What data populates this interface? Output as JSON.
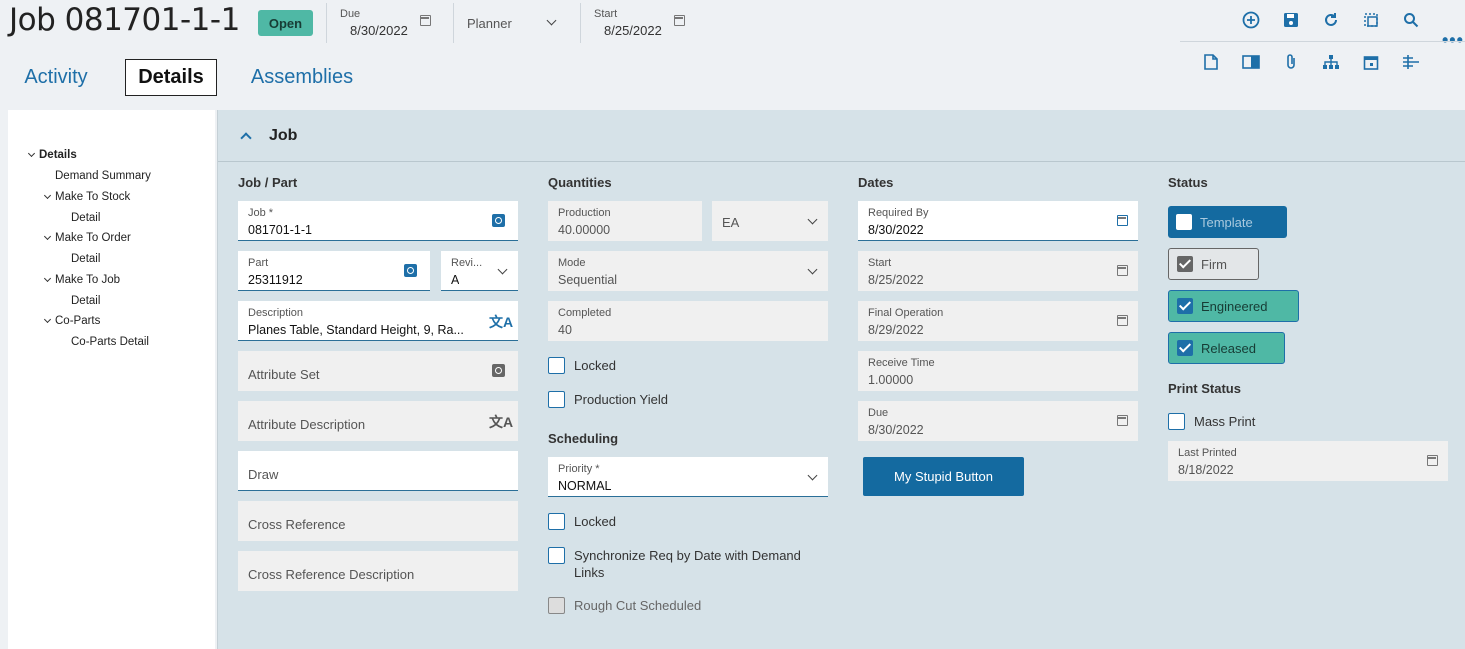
{
  "header": {
    "title": "Job 081701-1-1",
    "status_badge": "Open",
    "due_label": "Due",
    "due_value": "8/30/2022",
    "planner_value": "Planner",
    "start_label": "Start",
    "start_value": "8/25/2022",
    "more_label": "•••"
  },
  "toolbar_icons": [
    "add-icon",
    "save-icon",
    "refresh-icon",
    "select-icon",
    "search-icon",
    "document-icon",
    "panel-icon",
    "attachment-icon",
    "hierarchy-icon",
    "calendar-icon",
    "split-icon"
  ],
  "tabs": [
    {
      "label": "Activity"
    },
    {
      "label": "Details"
    },
    {
      "label": "Assemblies"
    }
  ],
  "tree": {
    "items": [
      {
        "label": "Details"
      },
      {
        "label": "Demand Summary"
      },
      {
        "label": "Make To Stock"
      },
      {
        "label": "Detail"
      },
      {
        "label": "Make To Order"
      },
      {
        "label": "Detail"
      },
      {
        "label": "Make To Job"
      },
      {
        "label": "Detail"
      },
      {
        "label": "Co-Parts"
      },
      {
        "label": "Co-Parts Detail"
      }
    ]
  },
  "panel": {
    "title": "Job",
    "job_part": {
      "section": "Job / Part",
      "job_label": "Job *",
      "job_value": "081701-1-1",
      "part_label": "Part",
      "part_value": "25311912",
      "rev_label": "Revi...",
      "rev_value": "A",
      "desc_label": "Description",
      "desc_value": "Planes Table, Standard Height, 9, Ra...",
      "attr_set": "Attribute Set",
      "attr_desc": "Attribute Description",
      "draw": "Draw",
      "cross_ref": "Cross Reference",
      "cross_ref_desc": "Cross Reference Description"
    },
    "quantities": {
      "section": "Quantities",
      "production_label": "Production",
      "production_value": "40.00000",
      "uom_value": "EA",
      "mode_label": "Mode",
      "mode_value": "Sequential",
      "completed_label": "Completed",
      "completed_value": "40",
      "locked": "Locked",
      "production_yield": "Production Yield"
    },
    "scheduling": {
      "section": "Scheduling",
      "priority_label": "Priority *",
      "priority_value": "NORMAL",
      "locked": "Locked",
      "sync_req": "Synchronize Req by Date with Demand Links",
      "rough_cut": "Rough Cut Scheduled"
    },
    "dates": {
      "section": "Dates",
      "required_by_label": "Required By",
      "required_by_value": "8/30/2022",
      "start_label": "Start",
      "start_value": "8/25/2022",
      "final_op_label": "Final Operation",
      "final_op_value": "8/29/2022",
      "receive_time_label": "Receive Time",
      "receive_time_value": "1.00000",
      "due_label": "Due",
      "due_value": "8/30/2022",
      "button_label": "My Stupid Button"
    },
    "status": {
      "section": "Status",
      "template": "Template",
      "firm": "Firm",
      "engineered": "Engineered",
      "released": "Released",
      "print_section": "Print Status",
      "mass_print": "Mass Print",
      "last_printed_label": "Last Printed",
      "last_printed_value": "8/18/2022"
    }
  },
  "colors": {
    "accent": "#1e6fa8",
    "teal": "#4fb8a5",
    "panel_bg": "#d6e2e8",
    "button": "#146aa0"
  }
}
